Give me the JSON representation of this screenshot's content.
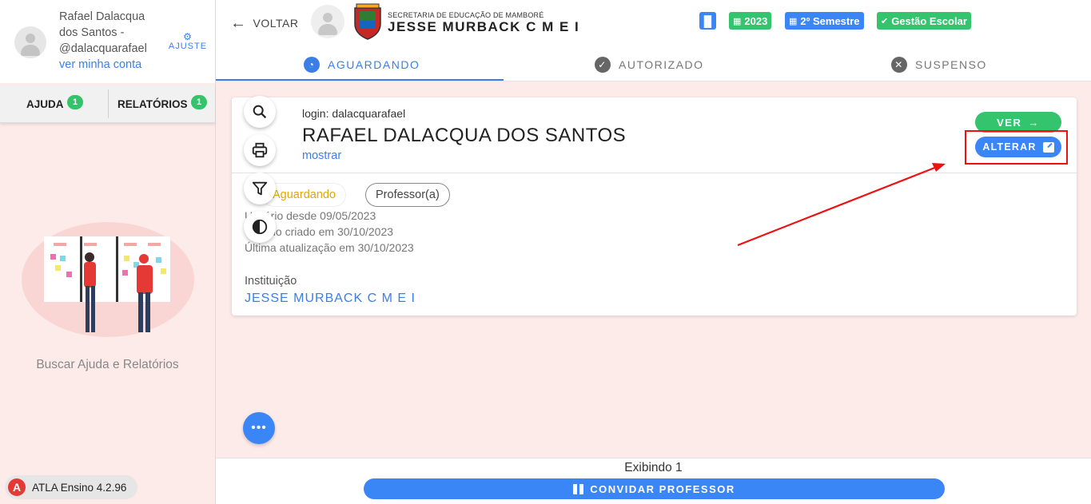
{
  "user": {
    "name": "Rafael Dalacqua dos Santos - @dalacquarafael",
    "account_link": "ver minha conta",
    "settings_label": "AJUSTE"
  },
  "sidebar": {
    "tabs": [
      {
        "label": "AJUDA",
        "badge": "1"
      },
      {
        "label": "RELATÓRIOS",
        "badge": "1"
      }
    ],
    "help_text": "Buscar Ajuda e Relatórios",
    "version": "ATLA Ensino 4.2.96"
  },
  "header": {
    "back_label": "VOLTAR",
    "secretaria": "SECRETARIA DE EDUCAÇÃO DE MAMBORÉ",
    "school": "JESSE MURBACK C M E I",
    "pills": [
      "2023",
      "2º Semestre",
      "Gestão Escolar"
    ]
  },
  "tabs": [
    {
      "label": "AGUARDANDO",
      "icon": "clock-icon"
    },
    {
      "label": "AUTORIZADO",
      "icon": "check-icon"
    },
    {
      "label": "SUSPENSO",
      "icon": "close-icon"
    }
  ],
  "card": {
    "login": "login: dalacquarafael",
    "full_name": "RAFAEL DALACQUA DOS SANTOS",
    "show_link": "mostrar",
    "ver_label": "VER",
    "alterar_label": "ALTERAR",
    "status_chip": "Aguardando",
    "role_chip": "Professor(a)",
    "meta": [
      "Usuário desde 09/05/2023",
      "Vínculo criado em 30/10/2023",
      "Última atualização em 30/10/2023"
    ],
    "institution_label": "Instituição",
    "institution_value": "JESSE MURBACK C M E I"
  },
  "footer": {
    "showing": "Exibindo 1",
    "invite_label": "CONVIDAR PROFESSOR"
  },
  "colors": {
    "primary": "#3b86f6",
    "success": "#34c46e",
    "warning": "#e0a800",
    "highlight": "#e11111"
  }
}
